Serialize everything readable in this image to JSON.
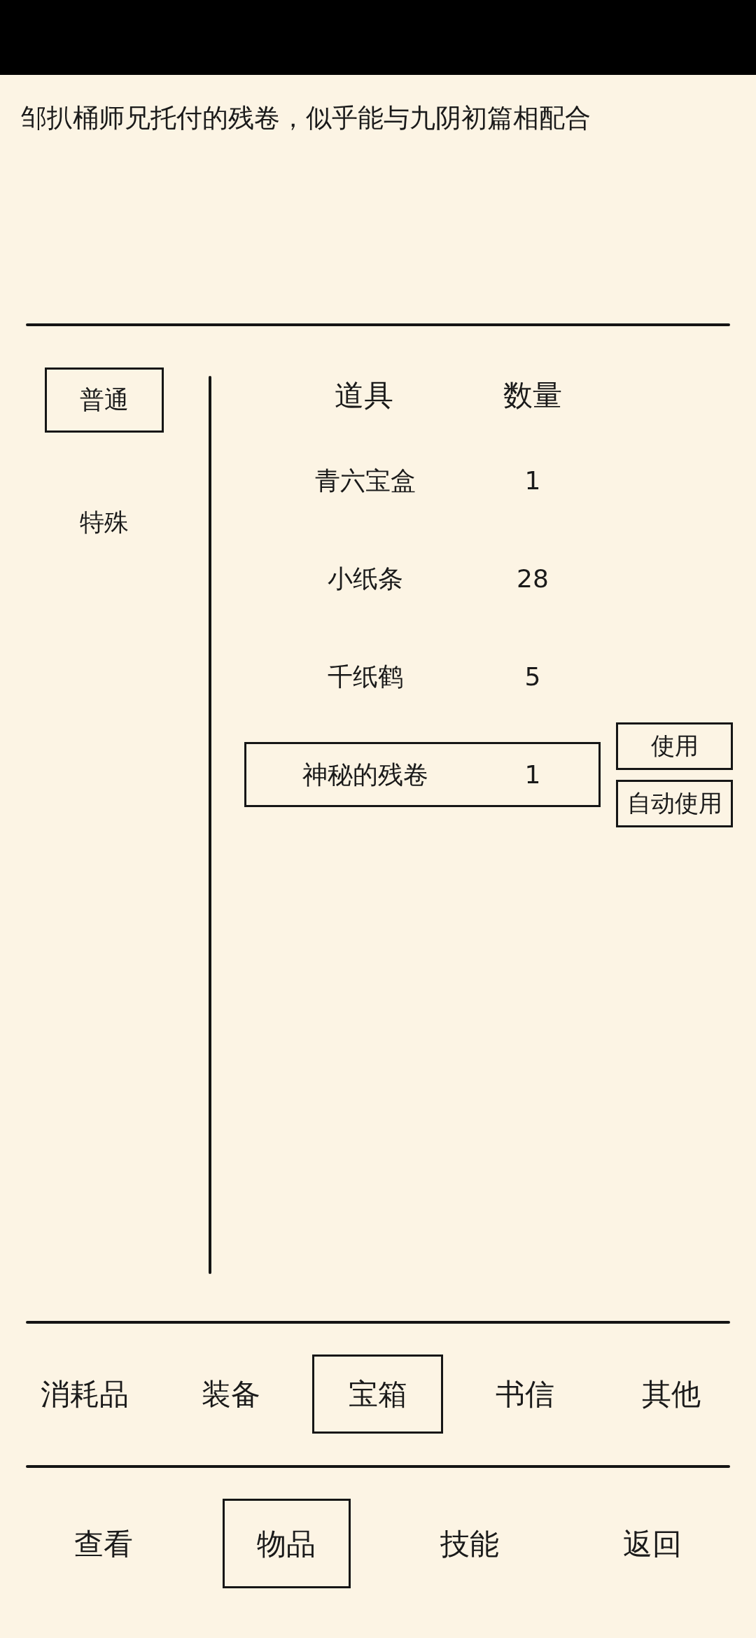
{
  "description": "邹扒桶师兄托付的残卷，似乎能与九阴初篇相配合",
  "sidebar": {
    "items": [
      {
        "label": "普通",
        "selected": true
      },
      {
        "label": "特殊",
        "selected": false
      }
    ]
  },
  "table": {
    "columns": [
      "道具",
      "数量"
    ],
    "rows": [
      {
        "name": "青六宝盒",
        "count": "1",
        "selected": false
      },
      {
        "name": "小纸条",
        "count": "28",
        "selected": false
      },
      {
        "name": "千纸鹤",
        "count": "5",
        "selected": false
      },
      {
        "name": "神秘的残卷",
        "count": "1",
        "selected": true
      }
    ]
  },
  "row_actions": [
    "使用",
    "自动使用"
  ],
  "category_tabs": [
    {
      "label": "消耗品",
      "selected": false
    },
    {
      "label": "装备",
      "selected": false
    },
    {
      "label": "宝箱",
      "selected": true
    },
    {
      "label": "书信",
      "selected": false
    },
    {
      "label": "其他",
      "selected": false
    }
  ],
  "bottom_nav": [
    {
      "label": "查看",
      "selected": false
    },
    {
      "label": "物品",
      "selected": true
    },
    {
      "label": "技能",
      "selected": false
    },
    {
      "label": "返回",
      "selected": false
    }
  ]
}
